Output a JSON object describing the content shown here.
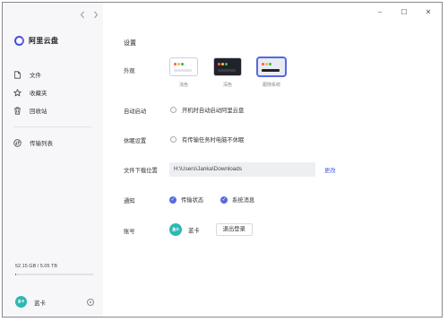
{
  "app": {
    "name": "阿里云盘"
  },
  "sidebar": {
    "items": [
      {
        "label": "文件",
        "icon": "file-icon"
      },
      {
        "label": "收藏夹",
        "icon": "star-icon"
      },
      {
        "label": "回收站",
        "icon": "trash-icon"
      }
    ],
    "transfer": {
      "label": "传输列表",
      "icon": "transfer-icon"
    },
    "storage": {
      "text": "52.15 GB / 5.05 TB",
      "used_fraction": 0.01
    },
    "user": {
      "avatar_text": "盖卡",
      "name": "蓝卡"
    }
  },
  "window_controls": {
    "minimize": "–",
    "maximize": "☐",
    "close": "✕"
  },
  "settings": {
    "title": "设置",
    "appearance": {
      "label": "外观",
      "themes": [
        {
          "name": "浅色",
          "bg": "#ffffff",
          "bar": "#e4e4ea"
        },
        {
          "name": "深色",
          "bg": "#22222a",
          "bar": "#3b3b48"
        },
        {
          "name": "跟随系统",
          "bg": "#e9ebf3",
          "bar": "#22222a"
        }
      ],
      "selected_index": 2
    },
    "autostart": {
      "label": "自动启动",
      "option": "开机时自动启动阿里云盘",
      "checked": false
    },
    "sleep": {
      "label": "休眠设置",
      "option": "有传输任务时电脑不休眠",
      "checked": false
    },
    "download": {
      "label": "文件下载位置",
      "path": "H:\\Users\\Janka\\Downloads",
      "change_label": "更改"
    },
    "notify": {
      "label": "通知",
      "options": [
        {
          "label": "传输状态",
          "checked": true
        },
        {
          "label": "系统消息",
          "checked": true
        }
      ]
    },
    "account": {
      "label": "账号",
      "avatar_text": "盖卡",
      "name": "蓝卡",
      "logout_label": "退出登录"
    }
  },
  "colors": {
    "accent": "#5569e0",
    "link": "#4a5ee8",
    "avatar": "#2eb8b0"
  }
}
